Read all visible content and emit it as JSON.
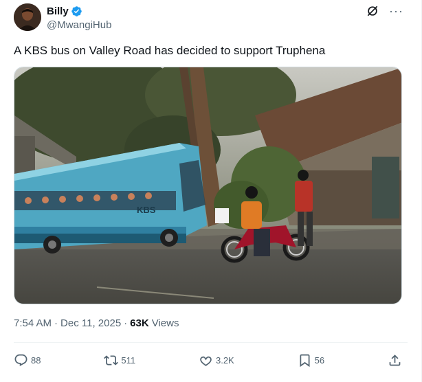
{
  "author": {
    "name": "Billy",
    "handle": "@MwangiHub",
    "verified_color": "#1d9bf0"
  },
  "tweet": {
    "text": "A KBS bus on Valley Road has decided to support Truphena",
    "media_alt": "KBS bus crashed into tree beside road with motorcyclists"
  },
  "media_text": {
    "bus_logo": "KBS"
  },
  "meta": {
    "time": "7:54 AM",
    "separator1": "·",
    "date": "Dec 11, 2025",
    "separator2": "·",
    "views_count": "63K",
    "views_label": "Views"
  },
  "actions": {
    "replies": "88",
    "reposts": "511",
    "likes": "3.2K",
    "bookmarks": "56"
  },
  "icons": {
    "reply": "reply-icon",
    "repost": "repost-icon",
    "like": "like-icon",
    "bookmark": "bookmark-icon",
    "share": "share-icon",
    "grok": "grok-icon",
    "more": "more-icon"
  }
}
